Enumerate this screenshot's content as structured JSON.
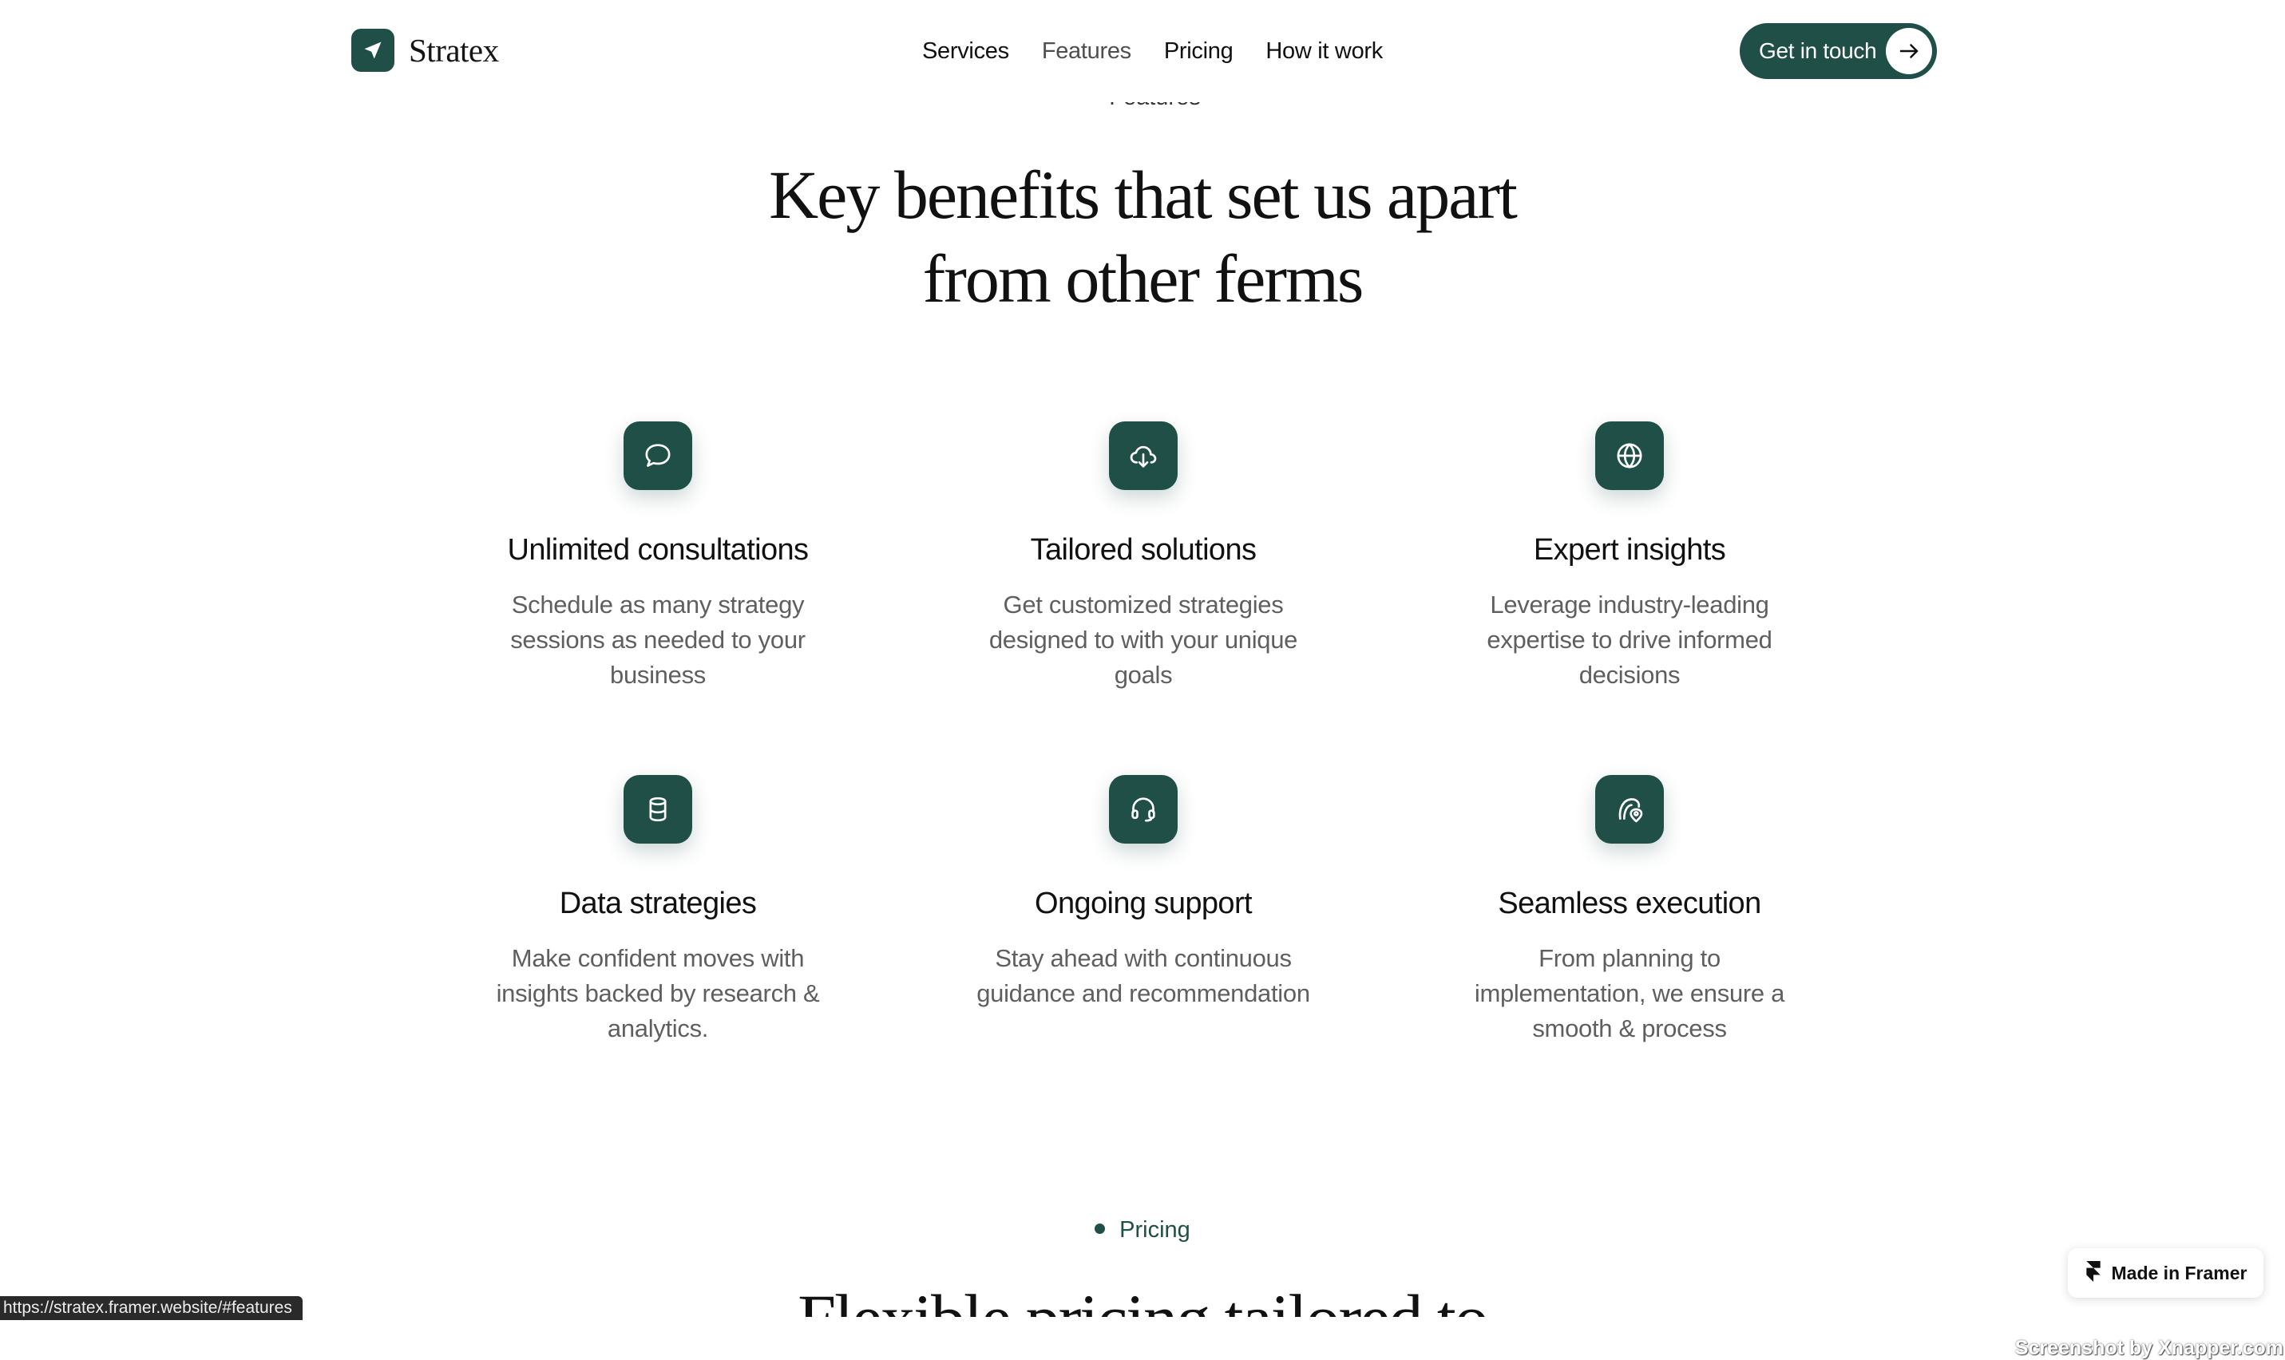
{
  "brand": {
    "name": "Stratex",
    "logo_icon": "paper-plane-icon"
  },
  "nav": {
    "items": [
      {
        "label": "Services"
      },
      {
        "label": "Features"
      },
      {
        "label": "Pricing"
      },
      {
        "label": "How it work"
      }
    ]
  },
  "cta": {
    "label": "Get in touch",
    "icon": "arrow-right-icon"
  },
  "features_section": {
    "eyebrow": "Features",
    "title_line1": "Key benefits that set us apart",
    "title_line2": "from other ferms",
    "items": [
      {
        "icon": "chat-bubble-icon",
        "title": "Unlimited consultations",
        "description": "Schedule as many strategy sessions as needed to your business"
      },
      {
        "icon": "cloud-download-icon",
        "title": "Tailored solutions",
        "description": "Get customized strategies designed to with your unique goals"
      },
      {
        "icon": "globe-icon",
        "title": "Expert insights",
        "description": "Leverage industry-leading expertise to drive informed decisions"
      },
      {
        "icon": "database-icon",
        "title": "Data strategies",
        "description": "Make confident moves with insights backed by research & analytics."
      },
      {
        "icon": "headset-icon",
        "title": "Ongoing support",
        "description": "Stay ahead with continuous guidance and recommendation"
      },
      {
        "icon": "map-pin-icon",
        "title": "Seamless execution",
        "description": "From planning to implementation, we ensure a smooth & process"
      }
    ]
  },
  "pricing_section": {
    "eyebrow": "Pricing",
    "title_partial": "Flexible pricing tailored to"
  },
  "status_bar": {
    "url": "https://stratex.framer.website/#features"
  },
  "framer_badge": {
    "label": "Made in Framer",
    "icon": "framer-logo-icon"
  },
  "watermark": {
    "text": "Screenshot by Xnapper.com"
  },
  "colors": {
    "accent": "#1f4f47",
    "text": "#111111",
    "muted_text": "#5f5f5f"
  }
}
